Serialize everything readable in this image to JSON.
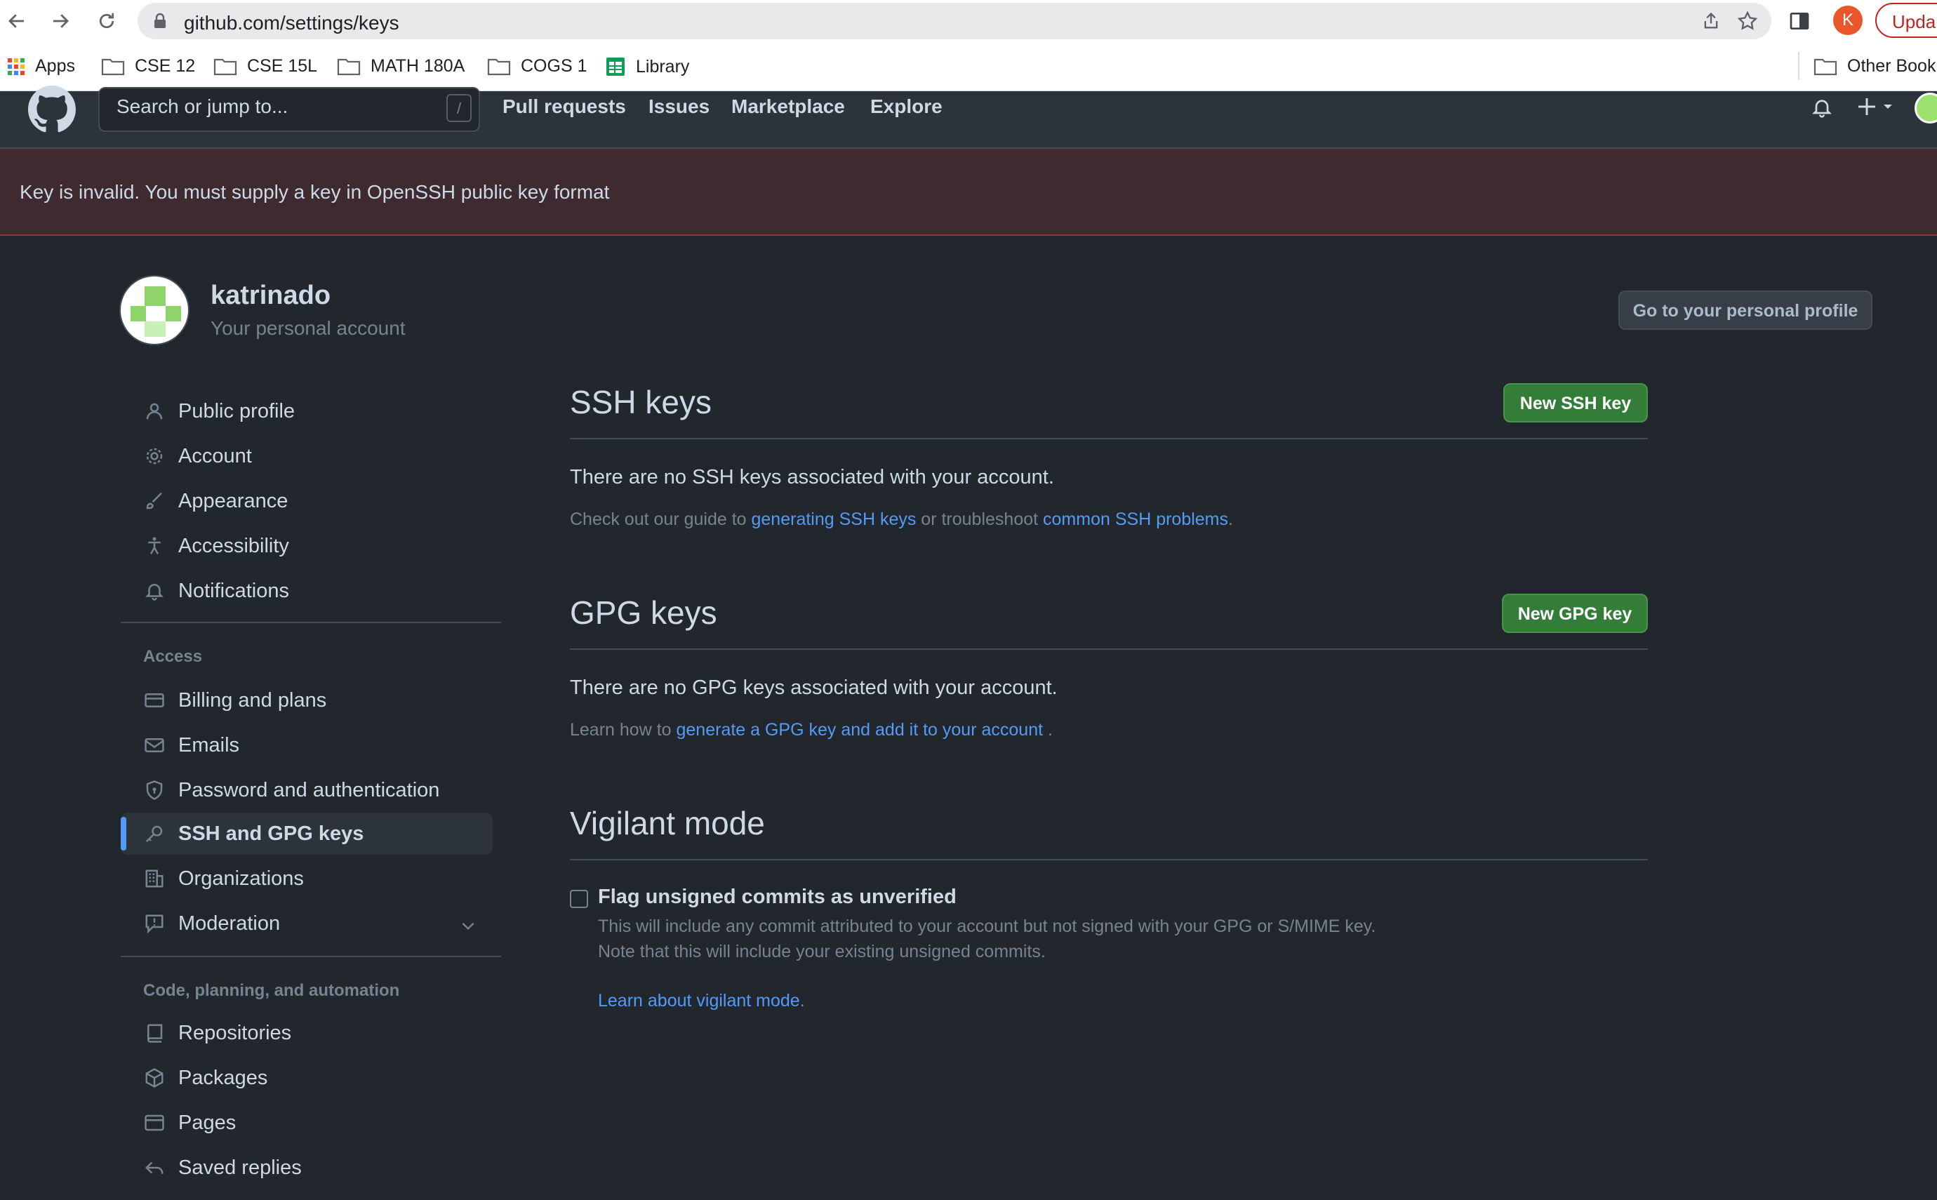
{
  "browser": {
    "url": "github.com/settings/keys",
    "profile_initial": "K",
    "update_label": "Upda",
    "bookmarks": [
      {
        "label": "Apps",
        "icon": "apps-grid-icon"
      },
      {
        "label": "CSE 12",
        "icon": "folder-icon"
      },
      {
        "label": "CSE 15L",
        "icon": "folder-icon"
      },
      {
        "label": "MATH 180A",
        "icon": "folder-icon"
      },
      {
        "label": "COGS 1",
        "icon": "folder-icon"
      },
      {
        "label": "Library",
        "icon": "library-sheet-icon"
      }
    ],
    "other_bookmarks": "Other Book"
  },
  "header": {
    "search_placeholder": "Search or jump to...",
    "search_shortcut": "/",
    "nav": [
      "Pull requests",
      "Issues",
      "Marketplace",
      "Explore"
    ]
  },
  "flash": {
    "message": "Key is invalid. You must supply a key in OpenSSH public key format",
    "color": "#3f2b2f"
  },
  "user": {
    "name": "katrinado",
    "subtitle": "Your personal account",
    "profile_button": "Go to your personal profile"
  },
  "sidebar": {
    "group1": [
      {
        "label": "Public profile",
        "icon": "person-icon"
      },
      {
        "label": "Account",
        "icon": "gear-icon"
      },
      {
        "label": "Appearance",
        "icon": "paintbrush-icon"
      },
      {
        "label": "Accessibility",
        "icon": "accessibility-icon"
      },
      {
        "label": "Notifications",
        "icon": "bell-icon"
      }
    ],
    "access_heading": "Access",
    "group2": [
      {
        "label": "Billing and plans",
        "icon": "credit-card-icon"
      },
      {
        "label": "Emails",
        "icon": "mail-icon"
      },
      {
        "label": "Password and authentication",
        "icon": "shield-lock-icon"
      },
      {
        "label": "SSH and GPG keys",
        "icon": "key-icon",
        "active": true
      },
      {
        "label": "Organizations",
        "icon": "organization-icon"
      },
      {
        "label": "Moderation",
        "icon": "report-icon"
      }
    ],
    "code_heading": "Code, planning, and automation",
    "group3": [
      {
        "label": "Repositories",
        "icon": "repo-icon"
      },
      {
        "label": "Packages",
        "icon": "package-icon"
      },
      {
        "label": "Pages",
        "icon": "browser-icon"
      },
      {
        "label": "Saved replies",
        "icon": "reply-icon"
      }
    ]
  },
  "ssh": {
    "title": "SSH keys",
    "button": "New SSH key",
    "empty": "There are no SSH keys associated with your account.",
    "help_prefix": "Check out our guide to ",
    "help_link1": "generating SSH keys",
    "help_middle": " or troubleshoot ",
    "help_link2": "common SSH problems",
    "help_suffix": "."
  },
  "gpg": {
    "title": "GPG keys",
    "button": "New GPG key",
    "empty": "There are no GPG keys associated with your account.",
    "help_prefix": "Learn how to ",
    "help_link": "generate a GPG key and add it to your account",
    "help_suffix": " ."
  },
  "vigilant": {
    "title": "Vigilant mode",
    "checkbox_label": "Flag unsigned commits as unverified",
    "checked": false,
    "note1": "This will include any commit attributed to your account but not signed with your GPG or S/MIME key.",
    "note2": "Note that this will include your existing unsigned commits.",
    "link": "Learn about vigilant mode."
  },
  "colors": {
    "background": "#22272e",
    "header": "#2d333b",
    "link": "#539bf5",
    "green_button": "#347d39",
    "active_bar": "#539bf5"
  }
}
